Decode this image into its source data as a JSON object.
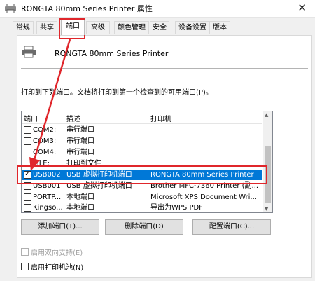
{
  "window": {
    "title": "RONGTA 80mm Series Printer 属性",
    "close": "✕"
  },
  "tabs": [
    "常规",
    "共享",
    "端口",
    "高级",
    "颜色管理",
    "安全",
    "设备设置",
    "版本"
  ],
  "printer_name": "RONGTA 80mm Series Printer",
  "instruction": "打印到下列端口。文档将打印到第一个检查到的可用端口(P)。",
  "list": {
    "headers": [
      "端口",
      "描述",
      "打印机"
    ],
    "rows": [
      {
        "port": "COM2:",
        "desc": "串行端口",
        "printer": "",
        "checked": false,
        "selected": false
      },
      {
        "port": "COM3:",
        "desc": "串行端口",
        "printer": "",
        "checked": false,
        "selected": false
      },
      {
        "port": "COM4:",
        "desc": "串行端口",
        "printer": "",
        "checked": false,
        "selected": false
      },
      {
        "port": "FILE:",
        "desc": "打印到文件",
        "printer": "",
        "checked": false,
        "selected": false
      },
      {
        "port": "USB002",
        "desc": "USB 虚拟打印机端口",
        "printer": "RONGTA 80mm Series Printer",
        "checked": true,
        "selected": true
      },
      {
        "port": "USB001",
        "desc": "USB 虚拟打印机端口",
        "printer": "Brother MFC-7360 Printer (副...",
        "checked": false,
        "selected": false
      },
      {
        "port": "PORTP...",
        "desc": "本地端口",
        "printer": "Microsoft XPS Document Wri...",
        "checked": false,
        "selected": false
      },
      {
        "port": "Kingso...",
        "desc": "本地端口",
        "printer": "导出为WPS PDF",
        "checked": false,
        "selected": false
      }
    ]
  },
  "buttons": {
    "add": "添加端口(T)...",
    "delete": "删除端口(D)",
    "config": "配置端口(C)..."
  },
  "options": {
    "bidirectional": "启用双向支持(E)",
    "pool": "启用打印机池(N)"
  },
  "colors": {
    "highlight": "#e0262b",
    "selection": "#0078d7"
  }
}
